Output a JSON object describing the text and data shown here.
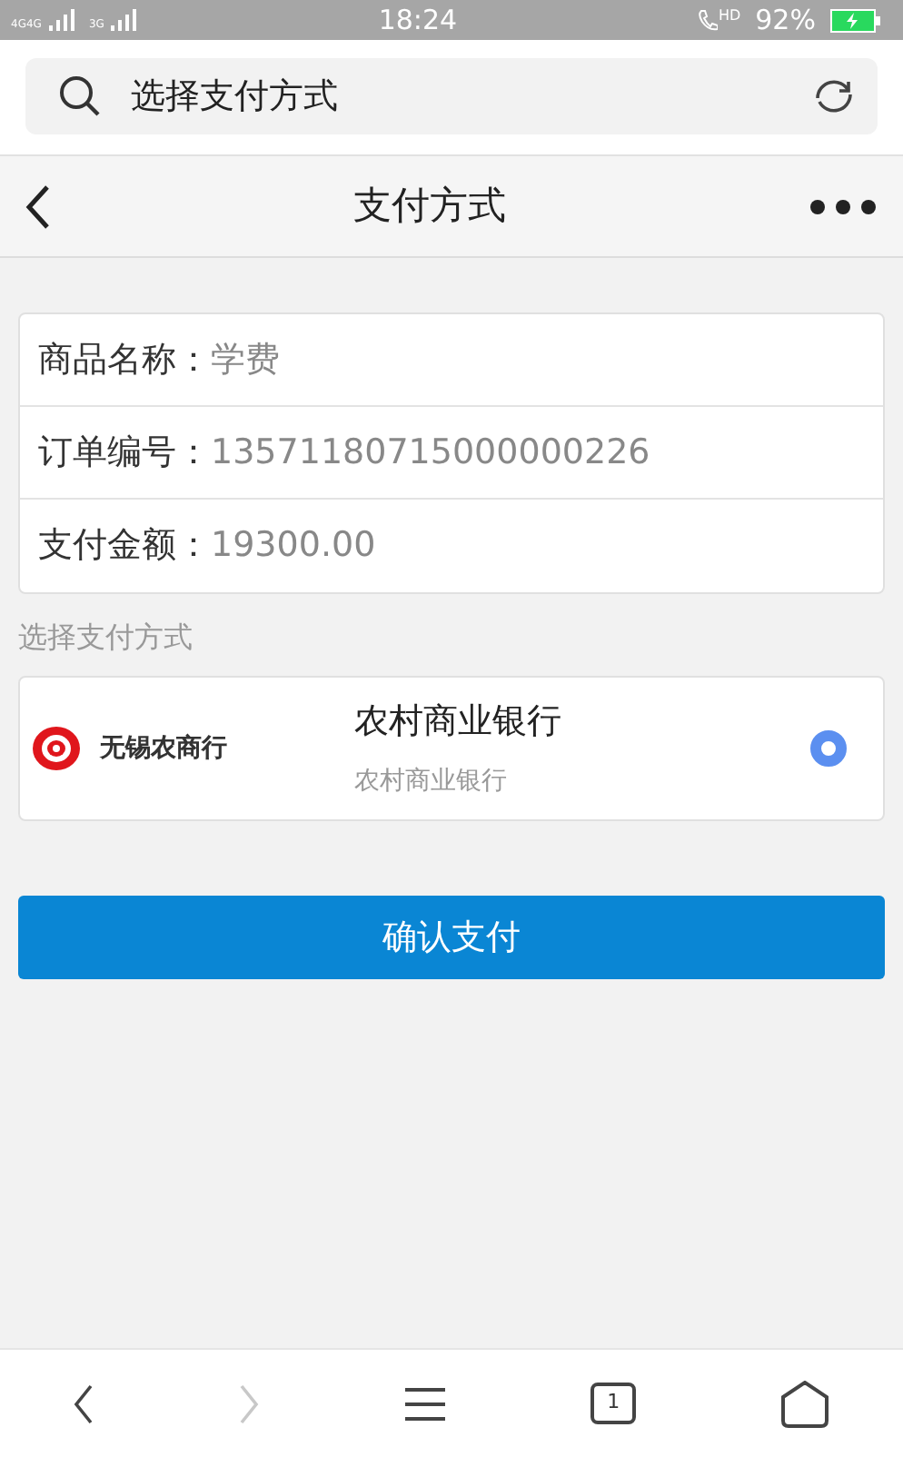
{
  "status_bar": {
    "networks": [
      "4G4G",
      "3G"
    ],
    "time": "18:24",
    "call_badge": "HD",
    "battery": "92%",
    "charging": true
  },
  "search": {
    "value": "选择支付方式"
  },
  "header": {
    "title": "支付方式"
  },
  "order_fields": [
    {
      "label": "商品名称：",
      "value": "学费"
    },
    {
      "label": "订单编号：",
      "value": "13571180715000000226"
    },
    {
      "label": "支付金额：",
      "value": "19300.00"
    }
  ],
  "section_label": "选择支付方式",
  "payment_methods": [
    {
      "logo_text": "无锡农商行",
      "name": "农村商业银行",
      "subtitle": "农村商业银行",
      "selected": true
    }
  ],
  "confirm_button": "确认支付",
  "bottom_bar": {
    "back_disabled": false,
    "forward_disabled": true,
    "tab_count": "1"
  }
}
